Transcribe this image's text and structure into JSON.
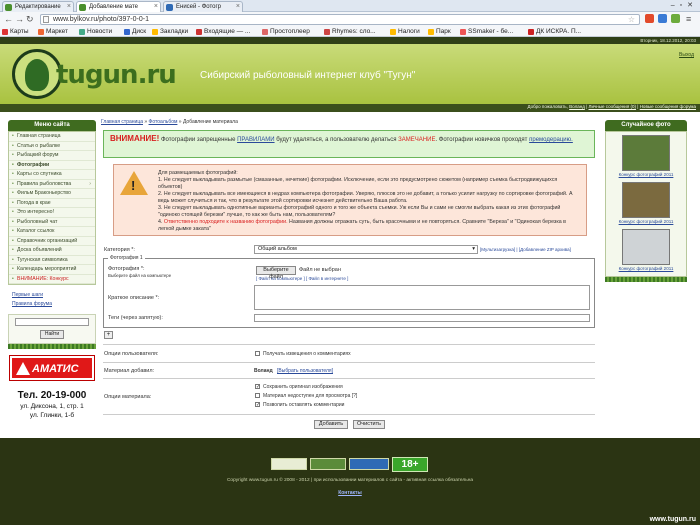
{
  "browser": {
    "tabs": [
      {
        "label": "Редактирование"
      },
      {
        "label": "Добавление мате"
      },
      {
        "label": "Енисей - Фотогр"
      }
    ],
    "url": "www.bylkov.ru/photo/397-0-0-1",
    "bookmarks": [
      "Карты",
      "Маркет",
      "Новости",
      "Диск",
      "Закладки",
      "Входящие — ...",
      "Простоплеер",
      "Rhymes: сло...",
      "Налоги",
      "Парк",
      "SSmaker - бе...",
      "ДК ИСКРА. П..."
    ]
  },
  "site": {
    "datetime": "Вторник, 18.12.2012, 20:03",
    "logo": "tugun.ru",
    "title": "Сибирский рыболовный интернет клуб \"Тугун\"",
    "exit": "Выход",
    "welcome": "Добро пожаловать",
    "user_link": "Воланд",
    "msgs": "Личные сообщения (0)",
    "forum_msgs": "Новые сообщения форума"
  },
  "sidebar": {
    "menu_title": "Меню сайта",
    "items": [
      {
        "label": "Главная страница",
        "style": ""
      },
      {
        "label": "Статьи о рыбалке",
        "style": ""
      },
      {
        "label": "Рыбацкий форум",
        "style": ""
      },
      {
        "label": "Фотографии",
        "style": "bold"
      },
      {
        "label": "Карты со спутника",
        "style": ""
      },
      {
        "label": "Правила рыболовства",
        "style": "arr"
      },
      {
        "label": "Фильм Браконьерство",
        "style": ""
      },
      {
        "label": "Погода в крае",
        "style": ""
      },
      {
        "label": "Это интересно!",
        "style": ""
      },
      {
        "label": "Рыболовный чат",
        "style": ""
      },
      {
        "label": "Каталог ссылок",
        "style": ""
      },
      {
        "label": "Справочник организаций",
        "style": ""
      },
      {
        "label": "Доска объявлений",
        "style": ""
      },
      {
        "label": "Тугунская символика",
        "style": ""
      },
      {
        "label": "Календарь мероприятий",
        "style": ""
      },
      {
        "label": "ВНИМАНИЕ: Конкурс",
        "style": "red"
      }
    ],
    "links": [
      "Первые шаги",
      "Правила форума"
    ],
    "search_button": "Найти",
    "ad_brand": "АМАТИС",
    "phone": "Тел. 20-19-000",
    "address1": "ул. Диксона, 1, стр. 1",
    "address2": "ул. Глинки, 1-б"
  },
  "right": {
    "title": "Случайное фото",
    "photos": [
      {
        "link": "Конкурс фотографий 2011",
        "color": "#5c7b3a"
      },
      {
        "link": "Конкурс фотографий 2011",
        "color": "#7b6a3f"
      },
      {
        "link": "Конкурс фотографий 2011",
        "color": "#cfd3d6"
      }
    ]
  },
  "main": {
    "breadcrumb": {
      "home": "Главная страница",
      "photos": "Фотоальбом",
      "current": "Добавление материала"
    },
    "warning": {
      "head": "ВНИМАНИЕ!",
      "t1": "Фотографии запрещенные",
      "rules": "ПРАВИЛАМИ",
      "t2": "будут удаляться, а пользователю делаться",
      "remark": "ЗАМЕЧАНИЕ",
      "t3": ". Фотографии новичков проходят",
      "premod": "премодерацию."
    },
    "notice": {
      "l0": "Для размещаемых фотографий:",
      "l1": "1. Не следует выкладывать размытые (смазанные, нечеткие) фотографии. Исключение, если это предусмотрено сюжетом (например съемка быстродвижущихся объектов)",
      "l2": "2. Не следует выкладывать все имеющиеся в недрах компьютера фотографии. Уверяю, плюсов это не добавит, а только усилит нагрузку по сортировке фотографий. А ведь может случиться и так, что в результате этой сортировки исчезнет действительно Ваша работа.",
      "l3": "3. Не следует выкладывать однотипные варианты фотографий одного и того же объекта съемки. Уж если Вы и сами не смогли выбрать какая из этих фотографий \"одиноко стоящей березки\" лучше, то как же быть нам, пользователям?",
      "l4a": "4. ",
      "l4red": "Ответственно подходите к названию фотографии.",
      "l4b": " Названия должны отражать суть, быть красочными и не повторяться. Сравните \"Береза\" и \"Одинокая березка в легкой дымке заката\""
    },
    "form": {
      "category_label": "Категория *:",
      "category_value": "Общий альбом",
      "right_links": "[Мультизагрузка] | [Добавление ZIP архива]",
      "legend": "Фотография 1",
      "photo_label": "Фотография *:",
      "photo_hint": "Выберите файл на компьютере",
      "file_button": "Выберите файл",
      "file_none": "Файл не выбран",
      "small_links": "[ Файл на компьютере ] [ Файл в интернете ]",
      "desc_label": "Краткое описание *:",
      "tags_label": "Теги (через запятую):",
      "plus": "+",
      "user_opts_label": "Опции пользователя:",
      "notify": "Получать извещения о комментариях",
      "added_label": "Материал добавил:",
      "author": "Воланд",
      "choose_user": "[Выбрать пользователя]",
      "mat_opts_label": "Опции материала:",
      "opt1": "Сохранить оригинал изображения",
      "opt2": "Материал недоступен для просмотра [?]",
      "opt3": "Позволить оставлять комментарии",
      "add_button": "Добавить",
      "clear_button": "Очистить"
    }
  },
  "footer": {
    "age": "18+",
    "copyright": "Copyright www.tugun.ru © 2008 - 2012 | при использовании материалов с сайта - активная ссылка обязательна",
    "contacts": "Контакты",
    "watermark": "www.tugun.ru"
  }
}
